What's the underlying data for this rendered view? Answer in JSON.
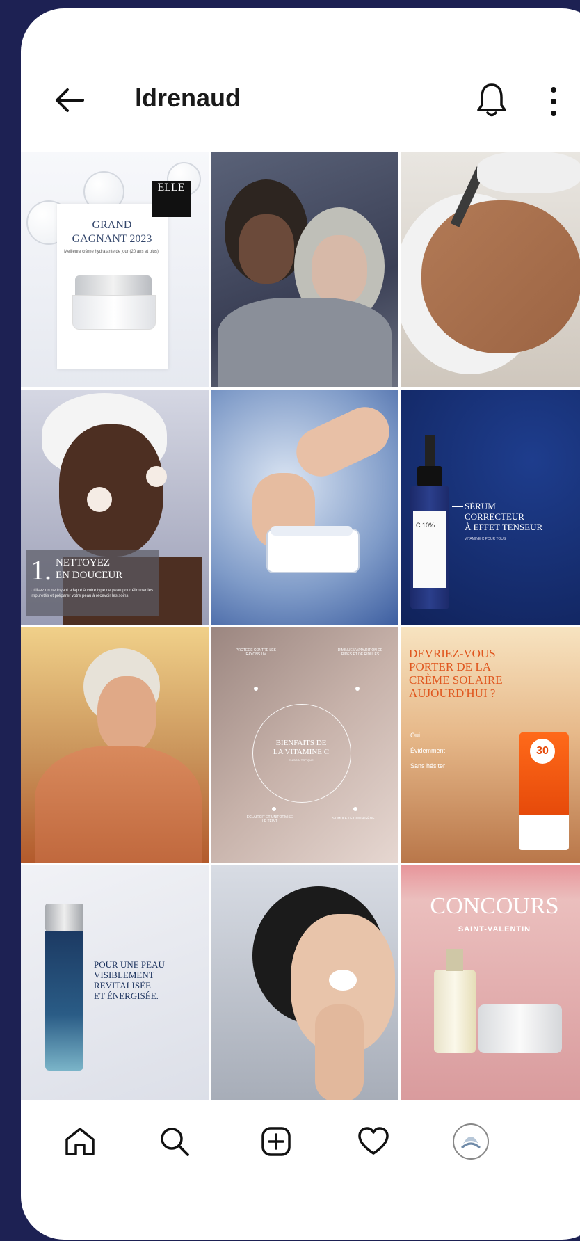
{
  "header": {
    "username": "ldrenaud"
  },
  "icons": {
    "back": "arrow-left-icon",
    "notifications": "bell-icon",
    "more": "more-vertical-icon",
    "home": "home-icon",
    "search": "search-icon",
    "create": "plus-square-icon",
    "activity": "heart-icon",
    "profile": "profile-avatar-icon"
  },
  "posts": [
    {
      "badge": "ELLE",
      "title": "GRAND\nGAGNANT 2023",
      "caption": "Meilleure crème hydratante de jour (20 ans et plus)"
    },
    {},
    {},
    {
      "number": "1.",
      "title": "NETTOYEZ\nEN DOUCEUR",
      "caption": "Utilisez un nettoyant adapté à votre type de peau pour éliminer les impuretés et préparer votre peau à recevoir les soins."
    },
    {},
    {
      "title": "SÉRUM\nCORRECTEUR\nÀ EFFET TENSEUR",
      "subtitle": "VITAMINE C POUR TOUS",
      "bottle_label": "C 10%"
    },
    {},
    {
      "center": "BIENFAITS DE\nLA VITAMINE C",
      "center_sub": "EN SOIN TOPIQUE",
      "points": [
        "PROTÈGE CONTRE LES RAYONS UV",
        "DIMINUE L'APPARITION DE RIDES ET DE RIDULES",
        "ÉCLAIRCIT ET UNIFORMISE LE TEINT",
        "STIMULE LE COLLAGÈNE"
      ]
    },
    {
      "title": "DEVRIEZ-VOUS\nPORTER DE LA\nCRÈME SOLAIRE\nAUJOURD'HUI ?",
      "options": [
        "Oui",
        "Évidemment",
        "Sans hésiter"
      ],
      "spf": "30"
    },
    {
      "title": "POUR UNE PEAU\nVISIBLEMENT\nREVITALISÉE\nET ÉNERGISÉE."
    },
    {},
    {
      "title": "CONCOURS",
      "subtitle": "SAINT-VALENTIN"
    }
  ]
}
